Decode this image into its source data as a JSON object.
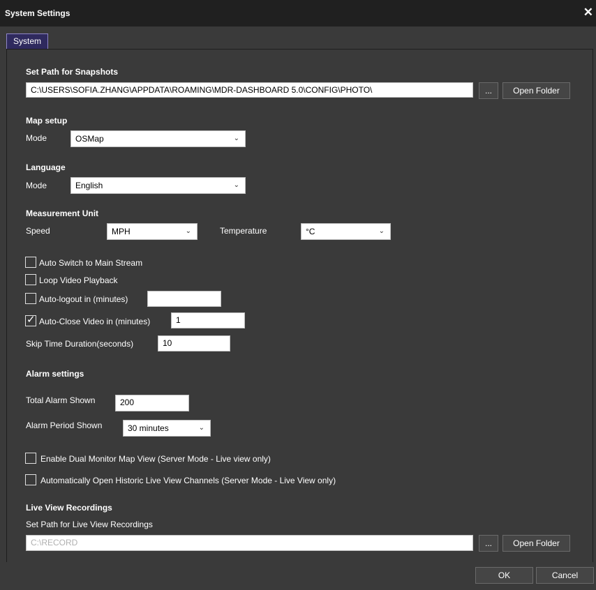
{
  "window": {
    "title": "System Settings",
    "close_glyph": "✕"
  },
  "tabs": [
    {
      "label": "System"
    }
  ],
  "snapshots": {
    "heading": "Set Path for Snapshots",
    "path": "C:\\USERS\\SOFIA.ZHANG\\APPDATA\\ROAMING\\MDR-DASHBOARD 5.0\\CONFIG\\PHOTO\\",
    "browse_label": "...",
    "open_folder_label": "Open Folder"
  },
  "map_setup": {
    "heading": "Map setup",
    "mode_label": "Mode",
    "mode_value": "OSMap"
  },
  "language": {
    "heading": "Language",
    "mode_label": "Mode",
    "mode_value": "English"
  },
  "measurement": {
    "heading": "Measurement Unit",
    "speed_label": "Speed",
    "speed_value": "MPH",
    "temperature_label": "Temperature",
    "temperature_value": "°C"
  },
  "options": {
    "auto_switch": {
      "label": "Auto Switch to Main Stream",
      "checked": false
    },
    "loop_video": {
      "label": "Loop Video Playback",
      "checked": false
    },
    "auto_logout": {
      "label": "Auto-logout in (minutes)",
      "checked": false,
      "value": ""
    },
    "auto_close": {
      "label": "Auto-Close Video in (minutes)",
      "checked": true,
      "value": "1"
    },
    "skip_time": {
      "label": "Skip Time Duration(seconds)",
      "value": "10"
    }
  },
  "alarm": {
    "heading": "Alarm settings",
    "total_label": "Total Alarm Shown",
    "total_value": "200",
    "period_label": "Alarm Period Shown",
    "period_value": "30 minutes"
  },
  "server_mode": {
    "dual_monitor": {
      "label": "Enable Dual Monitor Map View (Server Mode - Live view only)",
      "checked": false
    },
    "historic_channels": {
      "label": "Automatically Open Historic Live View Channels (Server Mode - Live View only)",
      "checked": false
    }
  },
  "recordings": {
    "heading": "Live View Recordings",
    "path_label": "Set Path for Live View Recordings",
    "path": "C:\\RECORD",
    "browse_label": "...",
    "open_folder_label": "Open Folder"
  },
  "footer": {
    "ok_label": "OK",
    "cancel_label": "Cancel"
  },
  "icons": {
    "checkmark": "check-icon",
    "chevron": "chevron-down-icon",
    "close": "close-icon"
  },
  "colors": {
    "background": "#3a3a3a",
    "titlebar": "#202020",
    "tab_active": "#2f2a5e",
    "tab_border": "#8e86c8"
  }
}
